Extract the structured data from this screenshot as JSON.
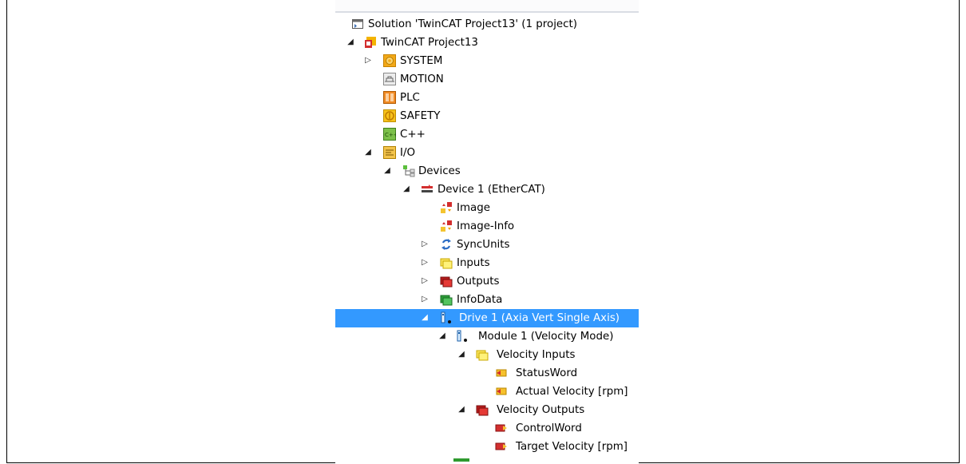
{
  "solution_explorer": {
    "items": [
      {
        "label": "Solution 'TwinCAT Project13' (1 project)",
        "icon": "solution-icon",
        "arrow": ""
      },
      {
        "label": "TwinCAT Project13",
        "icon": "twincat-project-icon",
        "arrow": "expanded"
      },
      {
        "label": "SYSTEM",
        "icon": "system-gear-icon",
        "arrow": "collapsed"
      },
      {
        "label": "MOTION",
        "icon": "motion-icon",
        "arrow": ""
      },
      {
        "label": "PLC",
        "icon": "plc-icon",
        "arrow": ""
      },
      {
        "label": "SAFETY",
        "icon": "safety-icon",
        "arrow": ""
      },
      {
        "label": "C++",
        "icon": "cpp-icon",
        "arrow": ""
      },
      {
        "label": "I/O",
        "icon": "io-icon",
        "arrow": "expanded"
      },
      {
        "label": "Devices",
        "icon": "devices-icon",
        "arrow": "expanded"
      },
      {
        "label": "Device 1 (EtherCAT)",
        "icon": "ethercat-device-icon",
        "arrow": "expanded"
      },
      {
        "label": "Image",
        "icon": "image-icon",
        "arrow": ""
      },
      {
        "label": "Image-Info",
        "icon": "image-info-icon",
        "arrow": ""
      },
      {
        "label": "SyncUnits",
        "icon": "syncunits-icon",
        "arrow": "collapsed"
      },
      {
        "label": "Inputs",
        "icon": "inputs-folder-icon",
        "arrow": "collapsed"
      },
      {
        "label": "Outputs",
        "icon": "outputs-folder-icon",
        "arrow": "collapsed"
      },
      {
        "label": "InfoData",
        "icon": "infodata-folder-icon",
        "arrow": "collapsed"
      },
      {
        "label": "Drive 1 (Axia Vert Single Axis)",
        "icon": "drive-icon",
        "arrow": "expanded",
        "selected": true
      },
      {
        "label": "Module 1 (Velocity Mode)",
        "icon": "module-icon",
        "arrow": "expanded"
      },
      {
        "label": "Velocity Inputs",
        "icon": "inputs-folder-icon",
        "arrow": "expanded"
      },
      {
        "label": "StatusWord",
        "icon": "input-variable-icon",
        "arrow": ""
      },
      {
        "label": "Actual Velocity [rpm]",
        "icon": "input-variable-icon",
        "arrow": ""
      },
      {
        "label": "Velocity Outputs",
        "icon": "outputs-folder-icon",
        "arrow": "expanded"
      },
      {
        "label": "ControlWord",
        "icon": "output-variable-icon",
        "arrow": ""
      },
      {
        "label": "Target Velocity [rpm]",
        "icon": "output-variable-icon",
        "arrow": ""
      }
    ],
    "selection_color": "#3399ff"
  }
}
